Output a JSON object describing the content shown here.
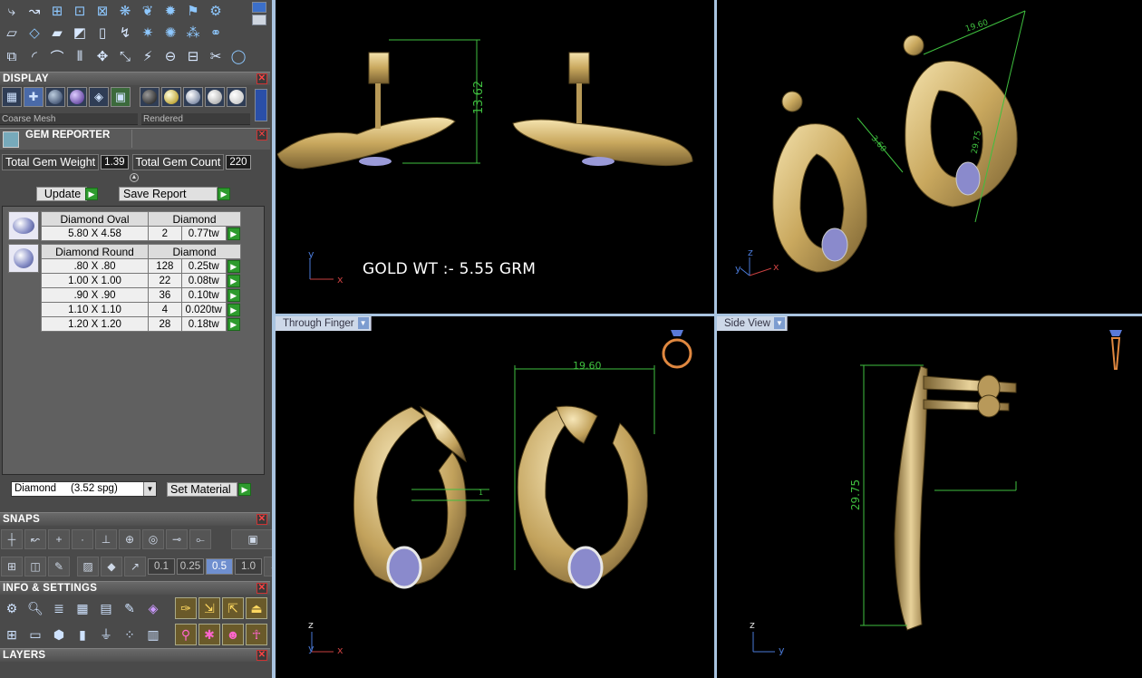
{
  "panels": {
    "display": {
      "title": "DISPLAY",
      "mesh_mode": "Coarse Mesh",
      "render_mode": "Rendered"
    },
    "gem_reporter": {
      "title": "GEM REPORTER",
      "total_weight_label": "Total Gem Weight",
      "total_weight_value": "1.39",
      "total_count_label": "Total Gem Count",
      "total_count_value": "220",
      "update_label": "Update",
      "save_report_label": "Save Report",
      "groups": [
        {
          "shape": "Diamond Oval",
          "material": "Diamond",
          "rows": [
            {
              "size": "5.80 X 4.58",
              "count": "2",
              "weight": "0.77tw"
            }
          ]
        },
        {
          "shape": "Diamond Round",
          "material": "Diamond",
          "rows": [
            {
              "size": ".80 X .80",
              "count": "128",
              "weight": "0.25tw"
            },
            {
              "size": "1.00 X 1.00",
              "count": "22",
              "weight": "0.08tw"
            },
            {
              "size": ".90 X .90",
              "count": "36",
              "weight": "0.10tw"
            },
            {
              "size": "1.10 X 1.10",
              "count": "4",
              "weight": "0.020tw"
            },
            {
              "size": "1.20 X 1.20",
              "count": "28",
              "weight": "0.18tw"
            }
          ]
        }
      ],
      "material_select": "Diamond     (3.52 spg)",
      "set_material_label": "Set Material"
    },
    "snaps": {
      "title": "SNAPS",
      "values": [
        "0.1",
        "0.25",
        "0.5",
        "1.0"
      ],
      "active_value": "0.5"
    },
    "info_settings": {
      "title": "INFO & SETTINGS"
    },
    "layers": {
      "title": "LAYERS"
    }
  },
  "viewports": {
    "top_left": {
      "annotation": "GOLD WT :- 5.55 GRM",
      "dimension": "13.62",
      "axes": [
        "y",
        "x"
      ]
    },
    "top_right": {
      "dimensions": [
        "19.60",
        "3.60",
        "29.75"
      ],
      "axes": [
        "y",
        "x",
        "z"
      ]
    },
    "bottom_left": {
      "label": "Through Finger",
      "dimension": "19.60",
      "dimension_small": "1",
      "axes": [
        "z",
        "y",
        "x"
      ]
    },
    "bottom_right": {
      "label": "Side View",
      "dimension": "29.75",
      "axes": [
        "z",
        "y"
      ]
    }
  },
  "colors": {
    "accent": "#a9c4e0",
    "dimension": "#3fbf3f",
    "gold": "#c9b27a",
    "gem": "#7a7fc0"
  }
}
